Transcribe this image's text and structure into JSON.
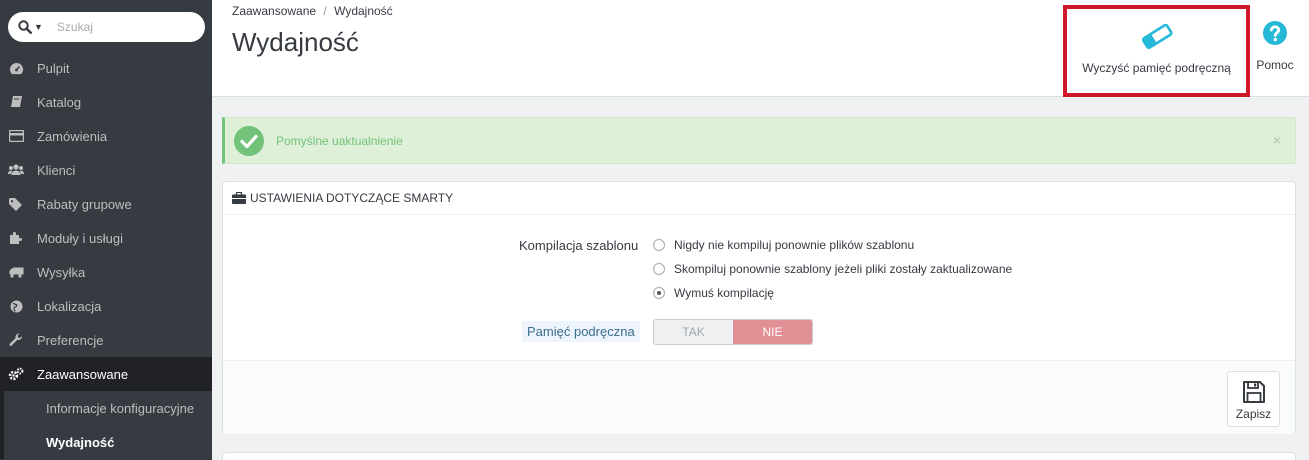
{
  "search": {
    "placeholder": "Szukaj"
  },
  "sidebar": {
    "items": [
      {
        "label": "Pulpit",
        "icon": "dashboard-icon"
      },
      {
        "label": "Katalog",
        "icon": "book-icon"
      },
      {
        "label": "Zamówienia",
        "icon": "credit-card-icon"
      },
      {
        "label": "Klienci",
        "icon": "users-icon"
      },
      {
        "label": "Rabaty grupowe",
        "icon": "tags-icon"
      },
      {
        "label": "Moduły i usługi",
        "icon": "puzzle-icon"
      },
      {
        "label": "Wysyłka",
        "icon": "truck-icon"
      },
      {
        "label": "Lokalizacja",
        "icon": "globe-icon"
      },
      {
        "label": "Preferencje",
        "icon": "wrench-icon"
      },
      {
        "label": "Zaawansowane",
        "icon": "cogs-icon",
        "active": true
      }
    ],
    "subitems": [
      {
        "label": "Informacje konfiguracyjne"
      },
      {
        "label": "Wydajność",
        "active": true
      }
    ]
  },
  "header": {
    "breadcrumb": [
      "Zaawansowane",
      "Wydajność"
    ],
    "breadcrumb_sep": "/",
    "title": "Wydajność",
    "clear_cache_label": "Wyczyść pamięć podręczną",
    "help_label": "Pomoc"
  },
  "alert": {
    "message": "Pomyślne uaktualnienie",
    "close": "×"
  },
  "panel": {
    "heading": "Ustawienia dotyczące Smarty",
    "compile_label": "Kompilacja szablonu",
    "compile_options": [
      {
        "label": "Nigdy nie kompiluj ponownie plików szablonu",
        "checked": false
      },
      {
        "label": "Skompiluj ponownie szablony jeżeli pliki zostały zaktualizowane",
        "checked": false
      },
      {
        "label": "Wymuś kompilację",
        "checked": true
      }
    ],
    "cache_label": "Pamięć podręczna",
    "switch_yes": "TAK",
    "switch_no": "NIE",
    "switch_selected": "NIE",
    "save_label": "Zapisz"
  },
  "colors": {
    "sidebar_bg": "#363a41",
    "active_bg": "#202226",
    "accent": "#25b9d7",
    "success": "#72c279",
    "danger_switch": "#e08f95",
    "highlight_border": "#d0182a"
  }
}
